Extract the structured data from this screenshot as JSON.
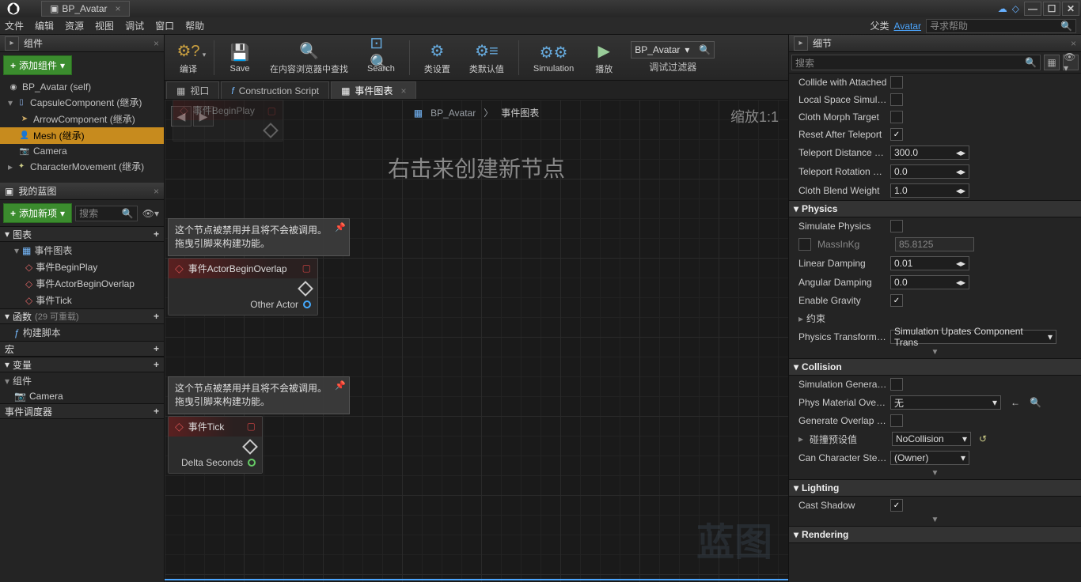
{
  "titlebar": {
    "tab_title": "BP_Avatar",
    "close_x": "×",
    "min": "—",
    "max": "☐",
    "close": "✕"
  },
  "menubar": {
    "file": "文件",
    "edit": "编辑",
    "asset": "资源",
    "view": "视图",
    "debug": "调试",
    "window": "窗口",
    "help": "帮助",
    "parent_label": "父类",
    "parent_link": "Avatar",
    "search_help": "寻求帮助"
  },
  "components_panel": {
    "title": "组件",
    "add_btn": "添加组件",
    "dropdown": "▾",
    "items": [
      {
        "name": "BP_Avatar (self)",
        "indent": 0
      },
      {
        "name": "CapsuleComponent (继承)",
        "indent": 1
      },
      {
        "name": "ArrowComponent (继承)",
        "indent": 2
      },
      {
        "name": "Mesh (继承)",
        "indent": 2,
        "selected": true
      },
      {
        "name": "Camera",
        "indent": 2
      },
      {
        "name": "CharacterMovement (继承)",
        "indent": 1
      }
    ]
  },
  "myblueprint": {
    "title": "我的蓝图",
    "add_btn": "添加新项",
    "search": "搜索",
    "graphs_hdr": "图表",
    "event_graph": "事件图表",
    "events": [
      "事件BeginPlay",
      "事件ActorBeginOverlap",
      "事件Tick"
    ],
    "functions_hdr": "函数",
    "functions_count": "(29 可重载)",
    "construction_script": "构建脚本",
    "macros_hdr": "宏",
    "variables_hdr": "变量",
    "components_sub": "组件",
    "camera_var": "Camera",
    "dispatchers_hdr": "事件调度器"
  },
  "toolbar": {
    "compile": "编译",
    "save": "Save",
    "browse": "在内容浏览器中查找",
    "search": "Search",
    "class_settings": "类设置",
    "class_defaults": "类默认值",
    "simulation": "Simulation",
    "play": "播放",
    "debug_filter": "调试过滤器",
    "bp_name": "BP_Avatar"
  },
  "graph_tabs": {
    "viewport": "视口",
    "construction": "Construction Script",
    "event_graph": "事件图表"
  },
  "graph": {
    "back": "◀",
    "fwd": "▶",
    "bc_root": "BP_Avatar",
    "bc_sep": "〉",
    "bc_leaf": "事件图表",
    "zoom": "缩放1:1",
    "hint": "右击来创建新节点",
    "watermark": "蓝图",
    "tooltip_line1": "这个节点被禁用并且将不会被调用。",
    "tooltip_line2": "拖曳引脚来构建功能。",
    "node_beginplay": "事件BeginPlay",
    "node_overlap": "事件ActorBeginOverlap",
    "pin_other_actor": "Other Actor",
    "node_tick": "事件Tick",
    "pin_delta": "Delta Seconds"
  },
  "details": {
    "title": "细节",
    "search": "搜索",
    "props": {
      "collide_attached": "Collide with Attached",
      "local_space_sim": "Local Space Simulation",
      "cloth_morph": "Cloth Morph Target",
      "reset_teleport": "Reset After Teleport",
      "teleport_dist": "Teleport Distance Threshold",
      "teleport_dist_val": "300.0",
      "teleport_rot": "Teleport Rotation Threshold",
      "teleport_rot_val": "0.0",
      "cloth_blend": "Cloth Blend Weight",
      "cloth_blend_val": "1.0"
    },
    "physics": {
      "hdr": "Physics",
      "simulate": "Simulate Physics",
      "mass": "MassInKg",
      "mass_val": "85.8125",
      "linear_damp": "Linear Damping",
      "linear_damp_val": "0.01",
      "angular_damp": "Angular Damping",
      "angular_damp_val": "0.0",
      "enable_gravity": "Enable Gravity",
      "constraints": "约束",
      "transform_update": "Physics Transform Update",
      "transform_update_val": "Simulation Upates Component Trans"
    },
    "collision": {
      "hdr": "Collision",
      "sim_generates": "Simulation Generates",
      "phys_mat": "Phys Material Override",
      "phys_mat_val": "无",
      "gen_overlap": "Generate Overlap Events",
      "preset": "碰撞预设值",
      "preset_val": "NoCollision",
      "can_step": "Can Character Step Up",
      "can_step_val": "(Owner)"
    },
    "lighting": {
      "hdr": "Lighting",
      "cast_shadow": "Cast Shadow"
    },
    "rendering": {
      "hdr": "Rendering"
    }
  }
}
